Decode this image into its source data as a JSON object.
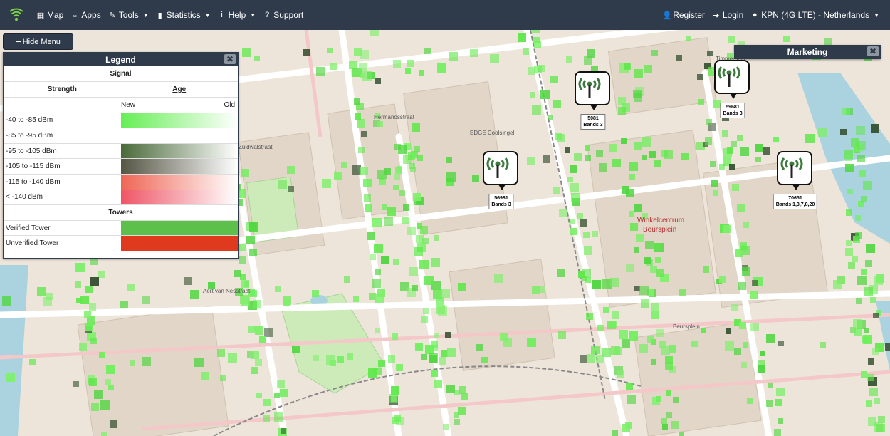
{
  "nav": {
    "left": [
      {
        "label": "Map",
        "icon": "map-icon",
        "glyph": "▦",
        "caret": false
      },
      {
        "label": "Apps",
        "icon": "download-icon",
        "glyph": "⤓",
        "caret": false
      },
      {
        "label": "Tools",
        "icon": "wrench-icon",
        "glyph": "✎",
        "caret": true
      },
      {
        "label": "Statistics",
        "icon": "bar-chart-icon",
        "glyph": "▮",
        "caret": true
      },
      {
        "label": "Help",
        "icon": "info-icon",
        "glyph": "i",
        "caret": true
      },
      {
        "label": "Support",
        "icon": "question-icon",
        "glyph": "?",
        "caret": false
      }
    ],
    "right": [
      {
        "label": "Register",
        "icon": "user-plus-icon",
        "glyph": "👤"
      },
      {
        "label": "Login",
        "icon": "login-icon",
        "glyph": "➜"
      },
      {
        "label": "KPN (4G LTE) - Netherlands",
        "icon": "map-marker-icon",
        "glyph": "●",
        "caret": true
      }
    ]
  },
  "hide_menu": {
    "label": "Hide Menu"
  },
  "legend": {
    "title": "Legend",
    "close": "✖",
    "signal_heading": "Signal",
    "strength_heading": "Strength",
    "age_heading": "Age",
    "new_label": "New",
    "old_label": "Old",
    "rows": [
      {
        "label": "-40 to -85 dBm",
        "color": "#66ee55"
      },
      {
        "label": "-85 to -95 dBm",
        "color": ""
      },
      {
        "label": "-95 to -105 dBm",
        "color": "#4a6a3a"
      },
      {
        "label": "-105 to -115 dBm",
        "color": "#555544"
      },
      {
        "label": "-115 to -140 dBm",
        "color": "#ee6655"
      },
      {
        "label": "< -140 dBm",
        "color": "#ee5566"
      }
    ],
    "towers_heading": "Towers",
    "towers": [
      {
        "label": "Verified Tower",
        "color": "#5cc04a"
      },
      {
        "label": "Unverified Tower",
        "color": "#e03a1e"
      }
    ]
  },
  "marketing": {
    "title": "Marketing",
    "close": "✖"
  },
  "towers": [
    {
      "id": "5081",
      "bands": "Bands 3"
    },
    {
      "id": "59681",
      "bands": "Bands 3"
    },
    {
      "id": "56981",
      "bands": "Bands 3"
    },
    {
      "id": "70651",
      "bands": "Bands 1,3,7,8,20"
    }
  ],
  "map_labels": [
    {
      "text": "Winkelcentrum",
      "cls": "big"
    },
    {
      "text": "Beursplein",
      "cls": "big"
    },
    {
      "text": "Timmerhuis",
      "cls": ""
    },
    {
      "text": "EDGE Coolsingel",
      "cls": ""
    },
    {
      "text": "Hermanosstraat",
      "cls": ""
    },
    {
      "text": "Zuidwalstraat",
      "cls": ""
    },
    {
      "text": "Beursplein",
      "cls": ""
    },
    {
      "text": "Aert van Nesstraat",
      "cls": ""
    }
  ]
}
